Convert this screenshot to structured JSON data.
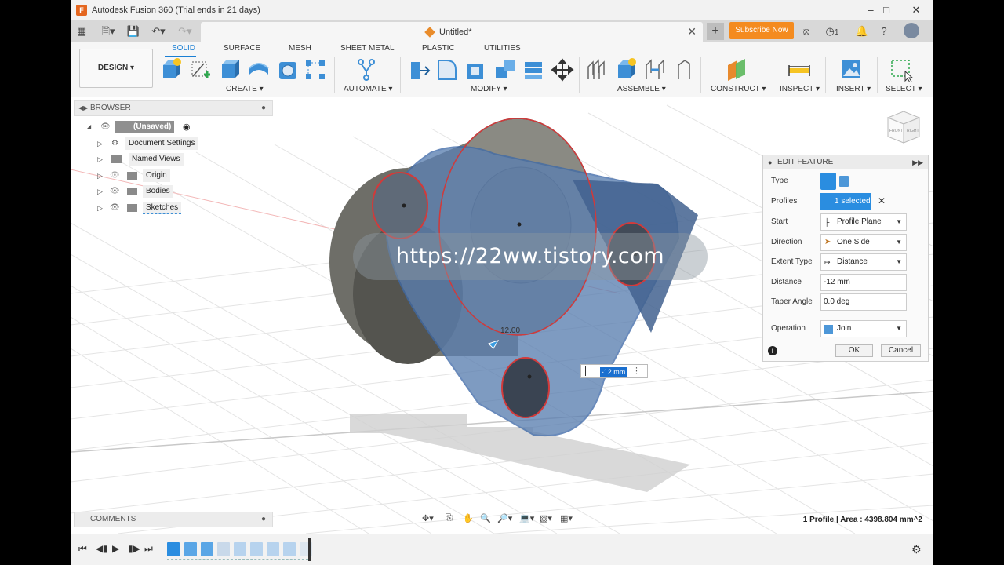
{
  "app": {
    "title": "Autodesk Fusion 360 (Trial ends in 21 days)",
    "logo": "F"
  },
  "tabs": {
    "document_name": "Untitled*",
    "subscribe_label": "Subscribe Now",
    "jobs_count": "1"
  },
  "toolbar": {
    "design_label": "DESIGN ▾",
    "workspace_tabs": [
      "SOLID",
      "SURFACE",
      "MESH",
      "SHEET METAL",
      "PLASTIC",
      "UTILITIES"
    ],
    "groups": [
      "CREATE ▾",
      "AUTOMATE ▾",
      "MODIFY ▾",
      "ASSEMBLE ▾",
      "CONSTRUCT ▾",
      "INSPECT ▾",
      "INSERT ▾",
      "SELECT ▾"
    ]
  },
  "browser": {
    "title": "BROWSER",
    "root": "(Unsaved)",
    "items": [
      "Document Settings",
      "Named Views",
      "Origin",
      "Bodies",
      "Sketches"
    ]
  },
  "edit_feature": {
    "title": "EDIT FEATURE",
    "labels": {
      "type": "Type",
      "profiles": "Profiles",
      "start": "Start",
      "direction": "Direction",
      "extent_type": "Extent Type",
      "distance": "Distance",
      "taper_angle": "Taper Angle",
      "operation": "Operation"
    },
    "profiles_value": "1 selected",
    "start_value": "Profile Plane",
    "direction_value": "One Side",
    "extent_value": "Distance",
    "distance_value": "-12 mm",
    "taper_value": "0.0 deg",
    "operation_value": "Join",
    "ok_label": "OK",
    "cancel_label": "Cancel"
  },
  "canvas": {
    "watermark": "https://22ww.tistory.com",
    "dimension_input": "-12 mm",
    "dimension_label": "12.00",
    "viewcube_front": "FRONT",
    "viewcube_right": "RIGHT"
  },
  "comments": {
    "title": "COMMENTS"
  },
  "status": {
    "text": "1 Profile | Area : 4398.804 mm^2"
  },
  "colors": {
    "accent": "#1a7fd4",
    "subscribe": "#f48b1f",
    "selection": "#5b87c5",
    "body": "#8a8a83"
  }
}
